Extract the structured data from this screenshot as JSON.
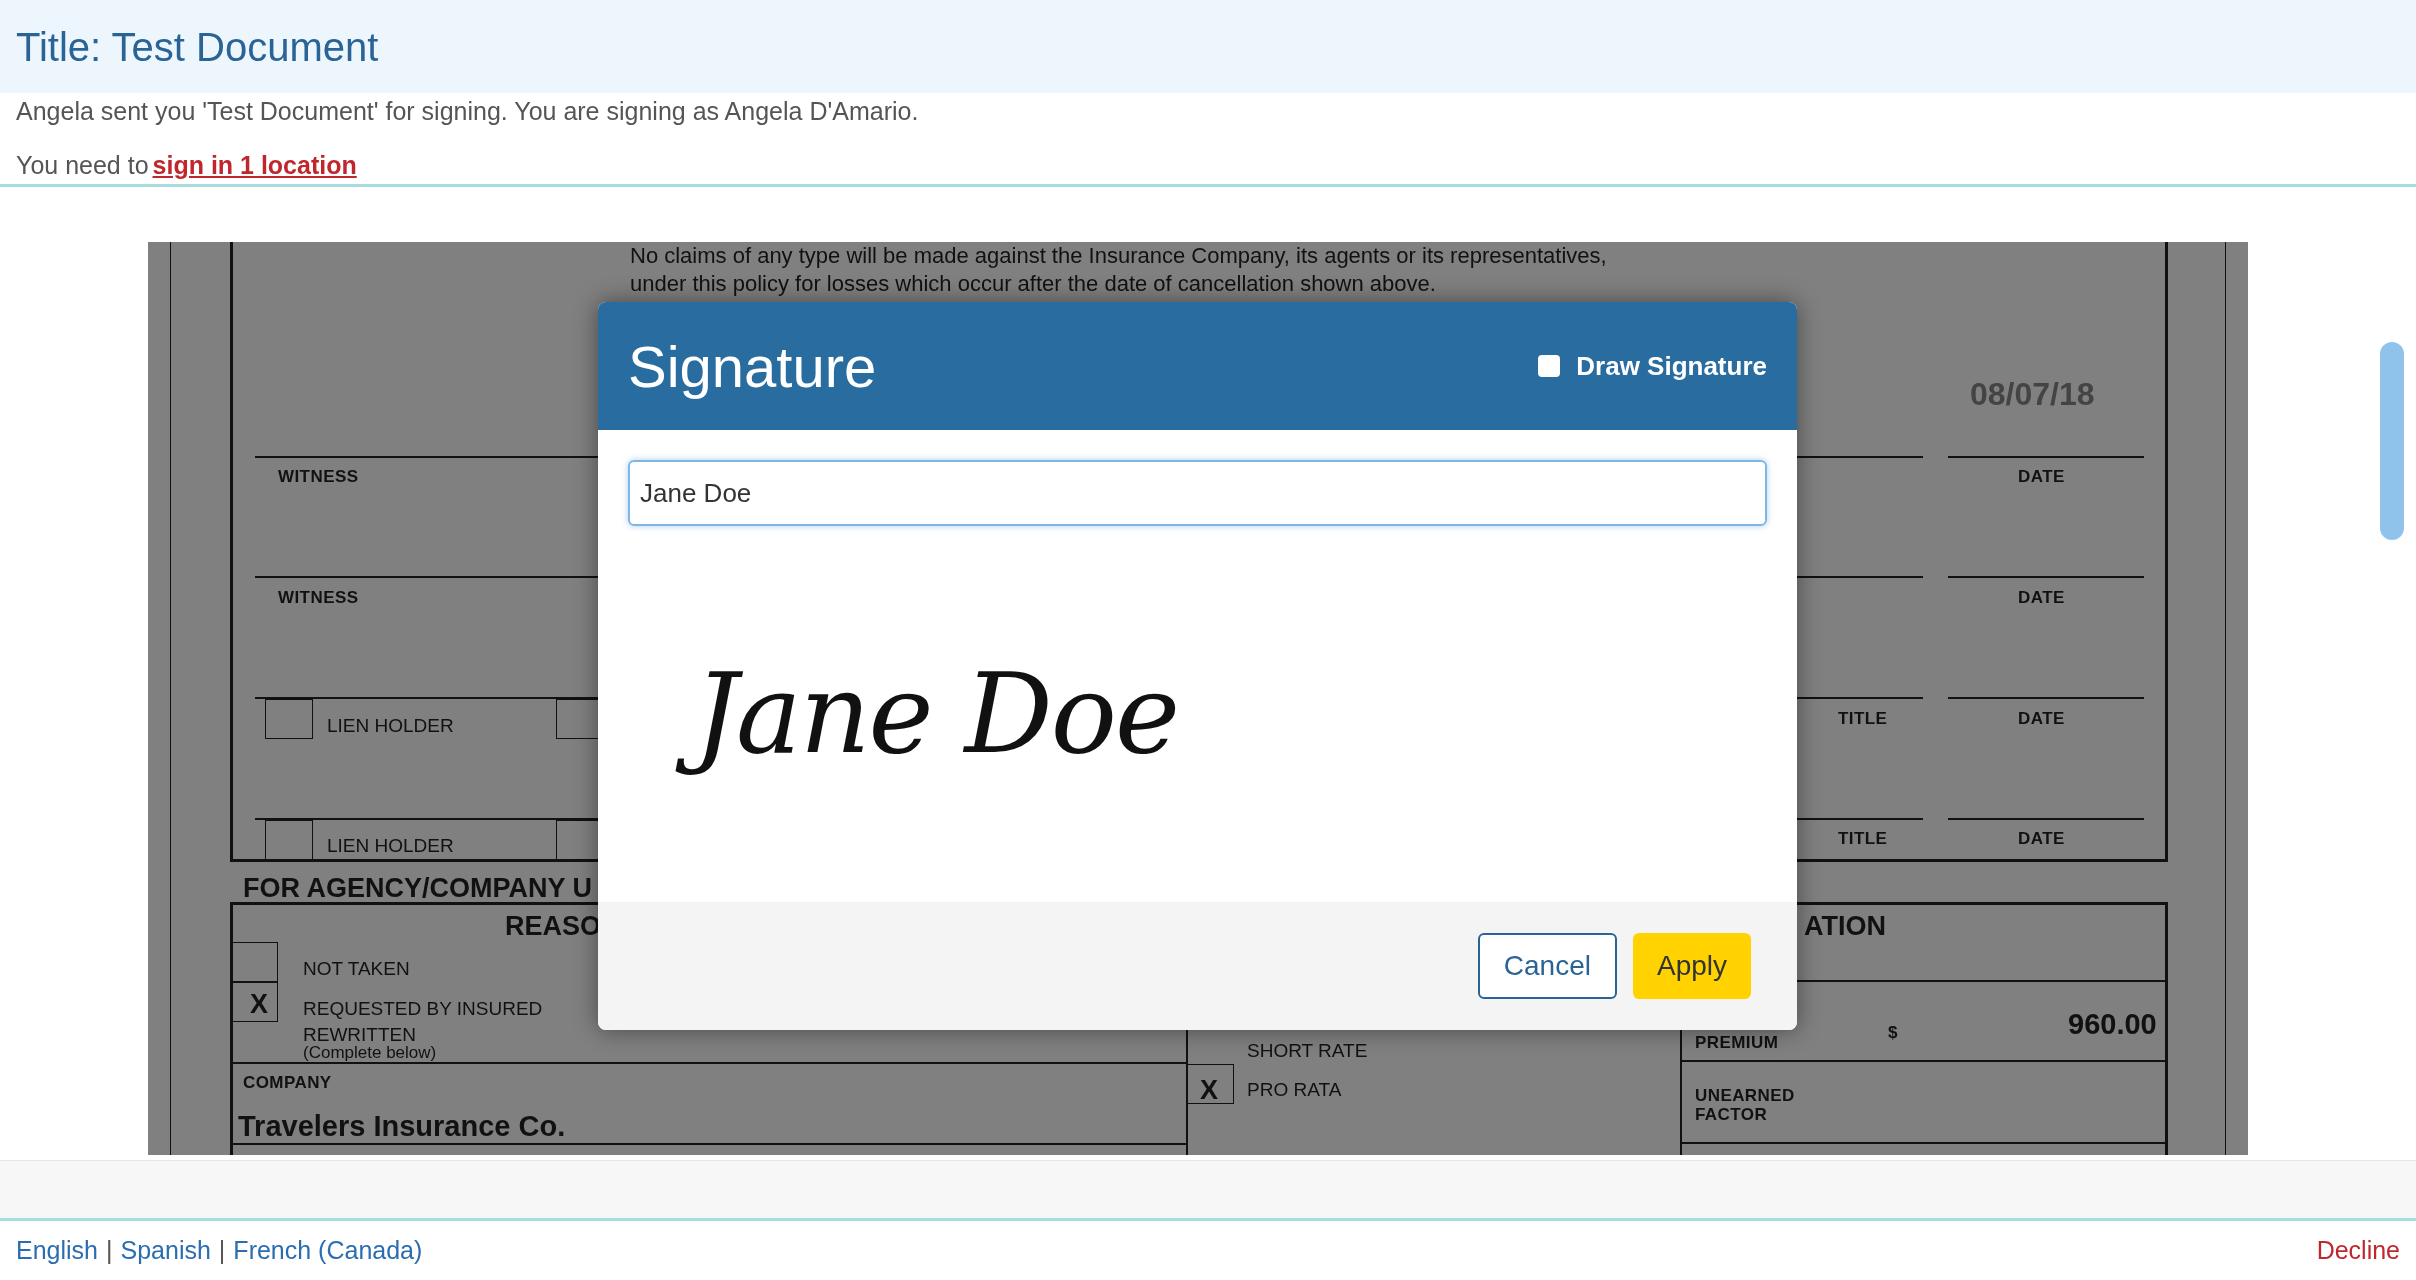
{
  "page_title": "Title: Test Document",
  "message": "Angela sent you 'Test Document' for signing. You are signing as Angela D'Amario.",
  "instruction": {
    "prefix": "You need to",
    "link": "sign in 1 location"
  },
  "document": {
    "texts": [
      {
        "kind": "body",
        "text": "No claims of any type will be made against the Insurance Company, its agents or its representatives,"
      },
      {
        "kind": "body",
        "text": "under this policy for losses which occur after the date of cancellation shown above."
      },
      {
        "kind": "date_value",
        "text": "08/07/18"
      },
      {
        "kind": "label",
        "text": "WITNESS"
      },
      {
        "kind": "label",
        "text": "WITNESS"
      },
      {
        "kind": "label",
        "text": "DATE"
      },
      {
        "kind": "label",
        "text": "DATE"
      },
      {
        "kind": "label",
        "text": "TITLE"
      },
      {
        "kind": "label",
        "text": "DATE"
      },
      {
        "kind": "plain",
        "text": "LIEN HOLDER"
      },
      {
        "kind": "label",
        "text": "TITLE"
      },
      {
        "kind": "label",
        "text": "DATE"
      },
      {
        "kind": "plain",
        "text": "LIEN HOLDER"
      },
      {
        "kind": "heading",
        "text": "FOR AGENCY/COMPANY U"
      },
      {
        "kind": "heading",
        "text": "REASO"
      },
      {
        "kind": "heading",
        "text": "ATION"
      },
      {
        "kind": "plain",
        "text": "NOT TAKEN"
      },
      {
        "kind": "mark",
        "text": "X"
      },
      {
        "kind": "plain",
        "text": "REQUESTED BY INSURED"
      },
      {
        "kind": "plain",
        "text": "REWRITTEN"
      },
      {
        "kind": "small",
        "text": "(Complete below)"
      },
      {
        "kind": "label",
        "text": "COMPANY"
      },
      {
        "kind": "value",
        "text": "Travelers Insurance Co."
      },
      {
        "kind": "plain",
        "text": "SHORT RATE"
      },
      {
        "kind": "mark",
        "text": "X"
      },
      {
        "kind": "plain",
        "text": "PRO RATA"
      },
      {
        "kind": "label",
        "text": "PREMIUM"
      },
      {
        "kind": "label",
        "text": "$"
      },
      {
        "kind": "value",
        "text": "960.00"
      },
      {
        "kind": "label",
        "text": "UNEARNED"
      },
      {
        "kind": "label",
        "text": "FACTOR"
      }
    ]
  },
  "dialog": {
    "title": "Signature",
    "draw_signature": {
      "label": "Draw Signature",
      "checked": false
    },
    "name_value": "Jane Doe",
    "signature_preview": "Jane Doe",
    "buttons": [
      {
        "kind": "secondary",
        "label": "Cancel"
      },
      {
        "kind": "primary",
        "label": "Apply"
      }
    ]
  },
  "footer": {
    "languages": [
      "English",
      "Spanish",
      "French (Canada)"
    ],
    "separator": "|",
    "decline": "Decline"
  }
}
